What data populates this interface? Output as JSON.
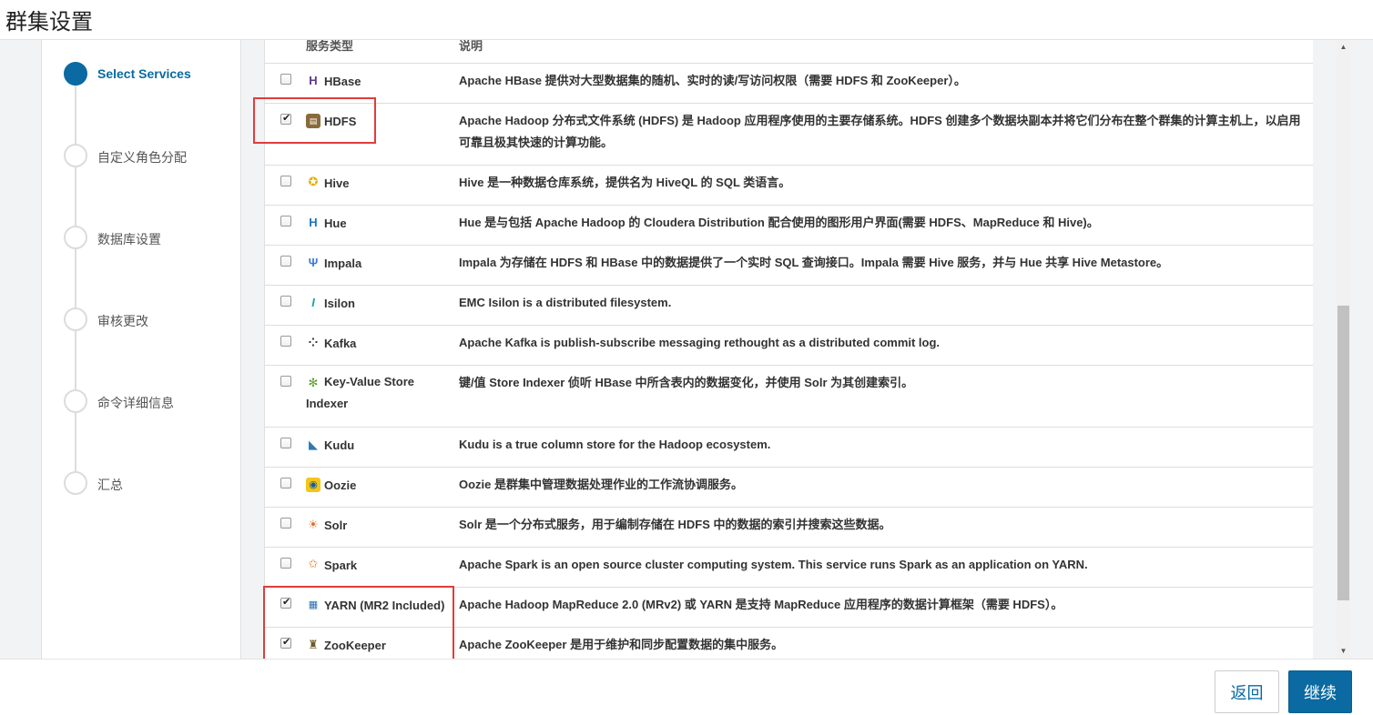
{
  "page": {
    "title": "群集设置"
  },
  "wizard": {
    "steps": [
      {
        "label": "Select Services",
        "active": true
      },
      {
        "label": "自定义角色分配",
        "active": false
      },
      {
        "label": "数据库设置",
        "active": false
      },
      {
        "label": "审核更改",
        "active": false
      },
      {
        "label": "命令详细信息",
        "active": false
      },
      {
        "label": "汇总",
        "active": false
      }
    ]
  },
  "table": {
    "headers": {
      "type": "服务类型",
      "desc": "说明"
    },
    "rows": [
      {
        "name": "HBase",
        "icon": "hbase-icon",
        "checked": false,
        "desc": "Apache HBase 提供对大型数据集的随机、实时的读/写访问权限（需要 HDFS 和 ZooKeeper）。"
      },
      {
        "name": "HDFS",
        "icon": "hdfs-icon",
        "checked": true,
        "desc": "Apache Hadoop 分布式文件系统 (HDFS) 是 Hadoop 应用程序使用的主要存储系统。HDFS 创建多个数据块副本并将它们分布在整个群集的计算主机上，以启用可靠且极其快速的计算功能。"
      },
      {
        "name": "Hive",
        "icon": "hive-icon",
        "checked": false,
        "desc": "Hive 是一种数据仓库系统，提供名为 HiveQL 的 SQL 类语言。"
      },
      {
        "name": "Hue",
        "icon": "hue-icon",
        "checked": false,
        "desc": "Hue 是与包括 Apache Hadoop 的 Cloudera Distribution 配合使用的图形用户界面(需要 HDFS、MapReduce 和 Hive)。"
      },
      {
        "name": "Impala",
        "icon": "impala-icon",
        "checked": false,
        "desc": "Impala 为存储在 HDFS 和 HBase 中的数据提供了一个实时 SQL 查询接口。Impala 需要 Hive 服务，并与 Hue 共享 Hive Metastore。"
      },
      {
        "name": "Isilon",
        "icon": "isilon-icon",
        "checked": false,
        "desc": "EMC Isilon is a distributed filesystem."
      },
      {
        "name": "Kafka",
        "icon": "kafka-icon",
        "checked": false,
        "desc": "Apache Kafka is publish-subscribe messaging rethought as a distributed commit log."
      },
      {
        "name": "Key-Value Store Indexer",
        "icon": "key-value-store-icon",
        "checked": false,
        "desc": "键/值 Store Indexer 侦听 HBase 中所含表内的数据变化，并使用 Solr 为其创建索引。"
      },
      {
        "name": "Kudu",
        "icon": "kudu-icon",
        "checked": false,
        "desc": "Kudu is a true column store for the Hadoop ecosystem."
      },
      {
        "name": "Oozie",
        "icon": "oozie-icon",
        "checked": false,
        "desc": "Oozie 是群集中管理数据处理作业的工作流协调服务。"
      },
      {
        "name": "Solr",
        "icon": "solr-icon",
        "checked": false,
        "desc": "Solr 是一个分布式服务，用于编制存储在 HDFS 中的数据的索引并搜索这些数据。"
      },
      {
        "name": "Spark",
        "icon": "spark-icon",
        "checked": false,
        "desc": "Apache Spark is an open source cluster computing system. This service runs Spark as an application on YARN."
      },
      {
        "name": "YARN (MR2 Included)",
        "icon": "yarn-icon",
        "checked": true,
        "desc": "Apache Hadoop MapReduce 2.0 (MRv2) 或 YARN 是支持 MapReduce 应用程序的数据计算框架（需要 HDFS）。"
      },
      {
        "name": "ZooKeeper",
        "icon": "zookeeper-icon",
        "checked": true,
        "desc": "Apache ZooKeeper 是用于维护和同步配置数据的集中服务。"
      }
    ]
  },
  "footer": {
    "back_label": "返回",
    "continue_label": "继续"
  },
  "colors": {
    "accent": "#0a6aa1",
    "highlight": "#e23b3b"
  }
}
